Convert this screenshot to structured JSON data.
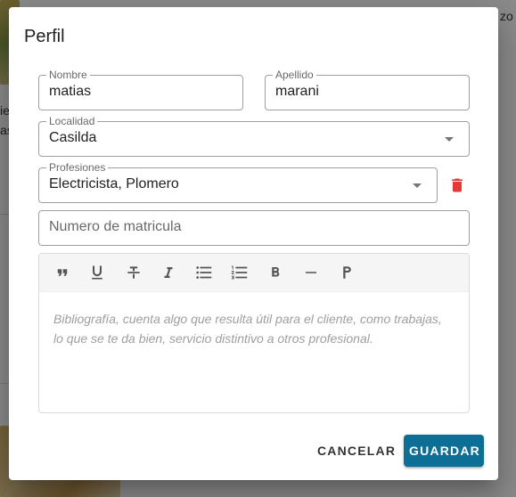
{
  "background": {
    "text_top_right": "zo",
    "text_left_1": "ie",
    "text_left_2": "as"
  },
  "dialog": {
    "title": "Perfil",
    "nombre": {
      "label": "Nombre",
      "value": "matias"
    },
    "apellido": {
      "label": "Apellido",
      "value": "marani"
    },
    "localidad": {
      "label": "Localidad",
      "value": "Casilda"
    },
    "profesiones": {
      "label": "Profesiones",
      "value": "Electricista, Plomero"
    },
    "matricula": {
      "placeholder": "Numero de matricula",
      "value": ""
    },
    "editor": {
      "toolbar": [
        "quote-icon",
        "underline-icon",
        "strikethrough-icon",
        "italic-icon",
        "bulleted-list-icon",
        "numbered-list-icon",
        "bold-icon",
        "horizontal-rule-icon",
        "paragraph-icon"
      ],
      "placeholder": "Bibliografía, cuenta algo que resulta útil para el cliente, como trabajas, lo que se te da bien, servicio distintivo a otros profesional."
    },
    "buttons": {
      "cancel": "CANCELAR",
      "save": "GUARDAR"
    }
  },
  "colors": {
    "primary": "#0e6f96",
    "delete": "#e53935",
    "overlay": "rgba(0,0,0,0.45)"
  }
}
